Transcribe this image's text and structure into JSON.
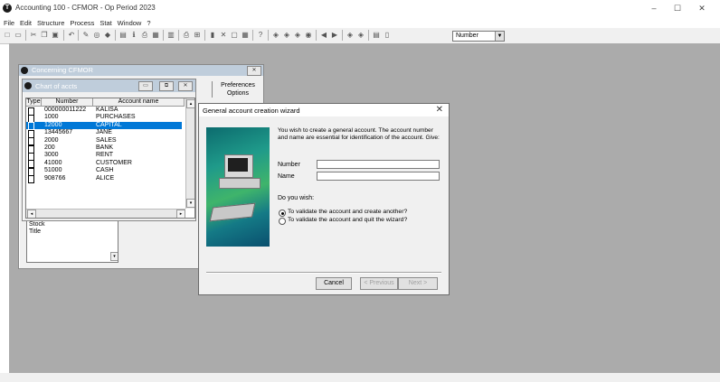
{
  "window": {
    "title": "Accounting 100 - CFMOR - Op Period 2023",
    "minimize": "–",
    "maximize": "☐",
    "close": "✕"
  },
  "menu": [
    "File",
    "Edit",
    "Structure",
    "Process",
    "Stat",
    "Window",
    "?"
  ],
  "toolbar": {
    "combo_value": "Number",
    "combo_arrow": "▼"
  },
  "concerning": {
    "title": "Concerning CFMOR",
    "tab_preferences": "Preferences",
    "tab_options": "Options",
    "list_items": [
      "Stock",
      "Title"
    ]
  },
  "chart_of_accts": {
    "title": "Chart of accts",
    "columns": {
      "type": "Type",
      "number": "Number",
      "name": "Account name"
    },
    "rows": [
      {
        "number": "000000011222",
        "name": "KALISA"
      },
      {
        "number": "1000",
        "name": "PURCHASES"
      },
      {
        "number": "12000",
        "name": "CAPITAL"
      },
      {
        "number": "13445667",
        "name": "JANE"
      },
      {
        "number": "2000",
        "name": "SALES"
      },
      {
        "number": "200",
        "name": "BANK"
      },
      {
        "number": "3000",
        "name": "RENT"
      },
      {
        "number": "41000",
        "name": "CUSTOMER"
      },
      {
        "number": "51000",
        "name": "CASH"
      },
      {
        "number": "908766",
        "name": "ALICE"
      }
    ],
    "selected_index": 2
  },
  "wizard": {
    "title": "General account creation wizard",
    "intro": "You wish to create a general account. The account number and name are essential for identification of the account. Give:",
    "number_label": "Number",
    "number_value": "",
    "name_label": "Name",
    "name_value": "",
    "do_you_wish": "Do you wish:",
    "option1": "To validate the account and create another?",
    "option2": "To validate the account and quit the wizard?",
    "selected_option": 1,
    "cancel": "Cancel",
    "previous": "< Previous",
    "next": "Next >"
  }
}
